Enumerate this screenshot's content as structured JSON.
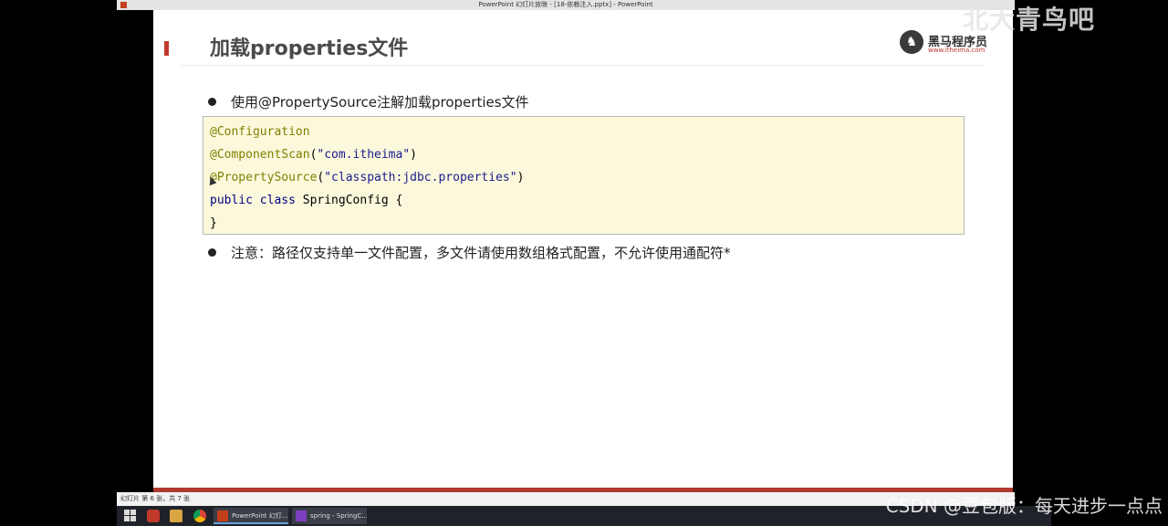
{
  "window": {
    "title": "PowerPoint 幻灯片放映 - [18-依赖注入.pptx] - PowerPoint"
  },
  "slide": {
    "title": "加载properties文件",
    "logo": {
      "name": "黑马程序员",
      "url": "www.itheima.com"
    },
    "bullets": [
      "使用@PropertySource注解加载properties文件",
      "注意：路径仅支持单一文件配置，多文件请使用数组格式配置，不允许使用通配符*"
    ],
    "code": {
      "line1_ann": "@Configuration",
      "line2_ann": "@ComponentScan",
      "line2_open": "(",
      "line2_str": "\"com.itheima\"",
      "line2_close": ")",
      "line3_ann": "@PropertySource",
      "line3_open": "(",
      "line3_str": "\"classpath:jdbc.properties\"",
      "line3_close": ")",
      "line4_kw": "public class",
      "line4_rest": " SpringConfig {",
      "line5": "}"
    }
  },
  "statusbar": {
    "text": "幻灯片 第 6 张，共 7 张"
  },
  "taskbar": {
    "tasks": [
      {
        "label": "PowerPoint 幻灯..."
      },
      {
        "label": "spring - SpringC..."
      }
    ]
  },
  "watermarks": {
    "top": "北大青鸟吧",
    "bottom": "CSDN @豆包版：每天进步一点点"
  },
  "colors": {
    "accent": "#c0392b",
    "code_bg": "#fbf8dc",
    "annotation": "#808000",
    "taskbar": "#1f2228"
  }
}
